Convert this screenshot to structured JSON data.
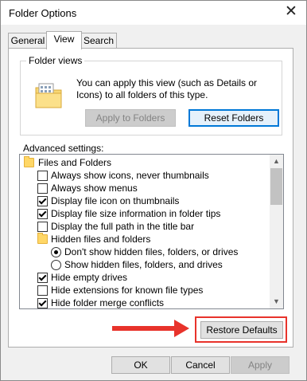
{
  "window": {
    "title": "Folder Options",
    "close_glyph": "✕"
  },
  "tabs": [
    {
      "label": "General"
    },
    {
      "label": "View",
      "selected": true
    },
    {
      "label": "Search"
    }
  ],
  "folder_views": {
    "legend": "Folder views",
    "description": "You can apply this view (such as Details or Icons) to all folders of this type.",
    "apply_button": "Apply to Folders",
    "reset_button": "Reset Folders"
  },
  "advanced": {
    "label": "Advanced settings:",
    "items": [
      {
        "type": "folder",
        "label": "Files and Folders",
        "indent": 0
      },
      {
        "type": "checkbox",
        "label": "Always show icons, never thumbnails",
        "checked": false,
        "indent": 1
      },
      {
        "type": "checkbox",
        "label": "Always show menus",
        "checked": false,
        "indent": 1
      },
      {
        "type": "checkbox",
        "label": "Display file icon on thumbnails",
        "checked": true,
        "indent": 1
      },
      {
        "type": "checkbox",
        "label": "Display file size information in folder tips",
        "checked": true,
        "indent": 1
      },
      {
        "type": "checkbox",
        "label": "Display the full path in the title bar",
        "checked": false,
        "indent": 1
      },
      {
        "type": "folder",
        "label": "Hidden files and folders",
        "indent": 1
      },
      {
        "type": "radio",
        "label": "Don't show hidden files, folders, or drives",
        "checked": true,
        "indent": 2
      },
      {
        "type": "radio",
        "label": "Show hidden files, folders, and drives",
        "checked": false,
        "indent": 2
      },
      {
        "type": "checkbox",
        "label": "Hide empty drives",
        "checked": true,
        "indent": 1
      },
      {
        "type": "checkbox",
        "label": "Hide extensions for known file types",
        "checked": false,
        "indent": 1
      },
      {
        "type": "checkbox",
        "label": "Hide folder merge conflicts",
        "checked": true,
        "indent": 1
      }
    ],
    "restore_button": "Restore Defaults"
  },
  "footer": {
    "ok": "OK",
    "cancel": "Cancel",
    "apply": "Apply"
  },
  "colors": {
    "annotation": "#e8332b",
    "focus_border": "#0078d7"
  },
  "icons": {
    "close": "close-icon",
    "folder": "folder-icon",
    "scroll_up": "▲",
    "scroll_down": "▼"
  }
}
